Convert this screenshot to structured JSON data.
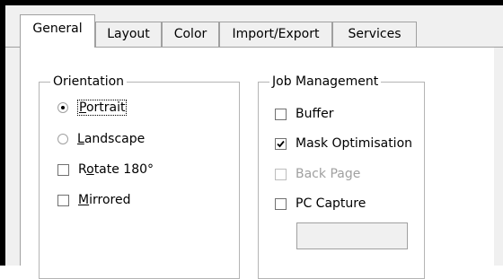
{
  "tabs": [
    {
      "label": "General",
      "active": true
    },
    {
      "label": "Layout",
      "active": false
    },
    {
      "label": "Color",
      "active": false
    },
    {
      "label": "Import/Export",
      "active": false
    },
    {
      "label": "Services",
      "active": false
    }
  ],
  "orientation": {
    "title": "Orientation",
    "portrait_first": "P",
    "portrait_rest": "ortrait",
    "landscape_first": "L",
    "landscape_rest": "andscape",
    "rotate_pre": "R",
    "rotate_u": "o",
    "rotate_rest": "tate 180°",
    "mirrored_first": "M",
    "mirrored_rest": "irrored",
    "selected": "Portrait",
    "rotate_checked": false,
    "mirrored_checked": false
  },
  "job_management": {
    "title": "Job Management",
    "buffer_label": "Buffer",
    "buffer_checked": false,
    "mask_label": "Mask Optimisation",
    "mask_checked": true,
    "backpage_label": "Back Page",
    "backpage_checked": false,
    "backpage_disabled": true,
    "pccapture_label": "PC Capture",
    "pccapture_checked": false,
    "pccapture_value": ""
  },
  "colors": {
    "window_bg": "#f0f0f0",
    "panel_bg": "#ffffff",
    "border": "#a0a0a0",
    "disabled_text": "#a0a0a0"
  }
}
